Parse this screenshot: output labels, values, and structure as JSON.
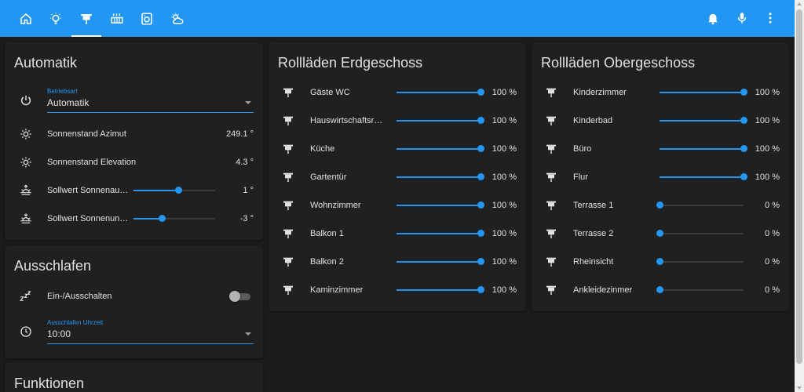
{
  "colors": {
    "accent": "#2196f3",
    "header": "#2196f3",
    "background": "#1c1c1c",
    "card": "#202020",
    "text": "#e1e1e1"
  },
  "header": {
    "tabs": [
      {
        "icon": "home-icon",
        "active": false
      },
      {
        "icon": "lightbulb-icon",
        "active": false
      },
      {
        "icon": "blinds-icon",
        "active": true
      },
      {
        "icon": "radiator-icon",
        "active": false
      },
      {
        "icon": "washing-machine-icon",
        "active": false
      },
      {
        "icon": "weather-partly-cloudy-icon",
        "active": false
      }
    ],
    "actions": [
      "bell-icon",
      "microphone-icon",
      "more-vertical-icon"
    ]
  },
  "automatik": {
    "title": "Automatik",
    "betriebsart_label": "Betriebsart",
    "betriebsart_value": "Automatik",
    "rows": [
      {
        "label": "Sonnenstand Azimut",
        "value": "249.1 °"
      },
      {
        "label": "Sonnenstand Elevation",
        "value": "4.3 °"
      },
      {
        "label": "Sollwert Sonnenaufgang",
        "value": "1 °",
        "level": 0.55
      },
      {
        "label": "Sollwert Sonnenuntergang",
        "value": "-3 °",
        "level": 0.35
      }
    ]
  },
  "ausschlafen": {
    "title": "Ausschlafen",
    "toggle_label": "Ein-/Ausschalten",
    "toggle_on": false,
    "time_label": "Ausschlafen Uhrzeit",
    "time_value": "10:00"
  },
  "funktionen": {
    "title": "Funktionen"
  },
  "erdgeschoss": {
    "title": "Rollläden Erdgeschoss",
    "items": [
      {
        "name": "Gäste WC",
        "value": "100 %",
        "level": 1.0
      },
      {
        "name": "Hauswirtschaftsraum",
        "value": "100 %",
        "level": 1.0
      },
      {
        "name": "Küche",
        "value": "100 %",
        "level": 1.0
      },
      {
        "name": "Gartentür",
        "value": "100 %",
        "level": 1.0
      },
      {
        "name": "Wohnzimmer",
        "value": "100 %",
        "level": 1.0
      },
      {
        "name": "Balkon 1",
        "value": "100 %",
        "level": 1.0
      },
      {
        "name": "Balkon 2",
        "value": "100 %",
        "level": 1.0
      },
      {
        "name": "Kaminzimmer",
        "value": "100 %",
        "level": 1.0
      }
    ]
  },
  "obergeschoss": {
    "title": "Rollläden Obergeschoss",
    "items": [
      {
        "name": "Kinderzimmer",
        "value": "100 %",
        "level": 1.0
      },
      {
        "name": "Kinderbad",
        "value": "100 %",
        "level": 1.0
      },
      {
        "name": "Büro",
        "value": "100 %",
        "level": 1.0
      },
      {
        "name": "Flur",
        "value": "100 %",
        "level": 1.0
      },
      {
        "name": "Terrasse 1",
        "value": "0 %",
        "level": 0.0
      },
      {
        "name": "Terrasse 2",
        "value": "0 %",
        "level": 0.0
      },
      {
        "name": "Rheinsicht",
        "value": "0 %",
        "level": 0.0
      },
      {
        "name": "Ankleidezinmer",
        "value": "0 %",
        "level": 0.0
      }
    ]
  }
}
